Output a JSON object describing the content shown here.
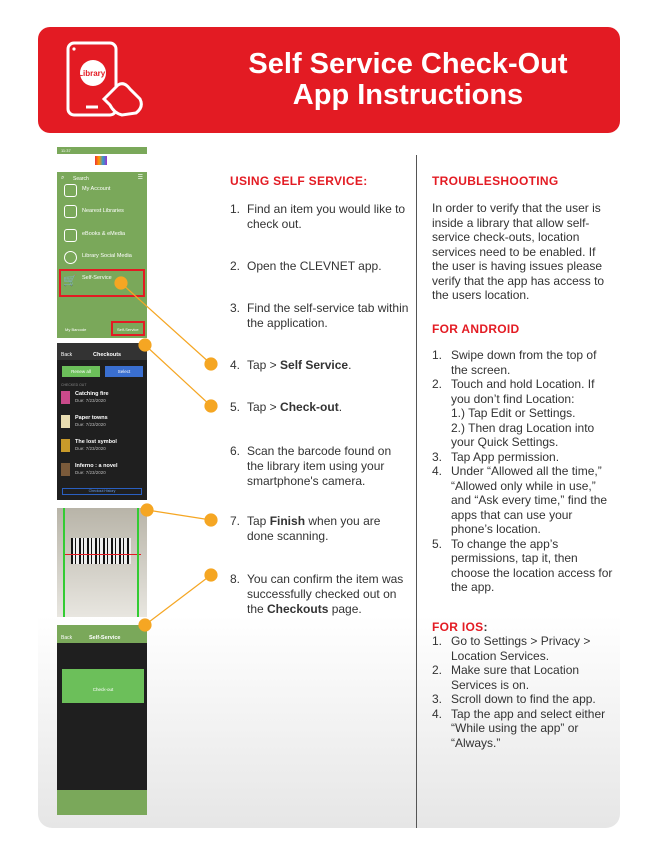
{
  "header": {
    "title_line1": "Self Service Check-Out",
    "title_line2": "App Instructions",
    "logo_text": "Library!"
  },
  "using": {
    "heading": "USING SELF SERVICE:",
    "steps": [
      {
        "n": "1.",
        "pre": "Find an item you would like to check out.",
        "bold": "",
        "post": ""
      },
      {
        "n": "2.",
        "pre": "Open the CLEVNET app.",
        "bold": "",
        "post": ""
      },
      {
        "n": "3.",
        "pre": "Find the self-service tab within the application.",
        "bold": "",
        "post": ""
      },
      {
        "n": "4.",
        "pre": "Tap > ",
        "bold": "Self Service",
        "post": "."
      },
      {
        "n": "5.",
        "pre": "Tap > ",
        "bold": "Check-out",
        "post": "."
      },
      {
        "n": "6.",
        "pre": "Scan the barcode found on the library item using your smartphone's camera.",
        "bold": "",
        "post": ""
      },
      {
        "n": "7.",
        "pre": "Tap ",
        "bold": "Finish",
        "post": " when you are done scanning."
      },
      {
        "n": "8.",
        "pre": "You can confirm the item was successfully checked out on the ",
        "bold": "Checkouts",
        "post": " page."
      }
    ]
  },
  "troubleshooting": {
    "heading": "TROUBLESHOOTING",
    "text": "In order to verify that the user is inside a library that allow self-service check-outs, location services need to be enabled. If the user is having issues please verify that the app has access to the users location."
  },
  "android": {
    "heading": "FOR ANDROID",
    "steps": [
      {
        "n": "1.",
        "text": "Swipe down from the top of the screen."
      },
      {
        "n": "2.",
        "text": "Touch and hold Location. If you don’t find Location:",
        "sub": [
          "1.) Tap Edit or Settings.",
          "2.) Then drag Location into your Quick Settings."
        ]
      },
      {
        "n": "3.",
        "text": "Tap App permission."
      },
      {
        "n": "4.",
        "text": "Under “Allowed all the time,” “Allowed only while in use,” and “Ask every time,” find the apps that can use your phone’s location."
      },
      {
        "n": "5.",
        "text": "To change the app’s permissions, tap it, then choose the location access for the app."
      }
    ]
  },
  "ios": {
    "heading": "FOR IOS",
    "colon": ":",
    "steps": [
      {
        "n": "1.",
        "text": "Go to Settings > Privacy > Location Services."
      },
      {
        "n": "2.",
        "text": "Make sure that Location Services is on."
      },
      {
        "n": "3.",
        "text": "Scroll down to find the app."
      },
      {
        "n": "4.",
        "text": "Tap the app and select either “While using the app” or “Always.”"
      }
    ]
  },
  "phone1": {
    "time": "11:37",
    "search": "Search",
    "menu": [
      "My Account",
      "Nearest Libraries",
      "eBooks & eMedia",
      "Library Social Media",
      "Self-Service"
    ],
    "bottom_left": "My Barcode",
    "bottom_right": "Self-Service"
  },
  "phone2": {
    "back": "Back",
    "title": "Checkouts",
    "renew": "Renew all",
    "select": "Select",
    "section": "CHECKED OUT",
    "books": [
      {
        "title": "Catching fire",
        "due": "Due: 7/23/2020",
        "color": "#c94a8a"
      },
      {
        "title": "Paper towns",
        "due": "Due: 7/23/2020",
        "color": "#e8dcb0"
      },
      {
        "title": "The lost symbol",
        "due": "Due: 7/23/2020",
        "color": "#c89a2a"
      },
      {
        "title": "Inferno : a novel",
        "due": "Due: 7/23/2020",
        "color": "#7a5a3a"
      }
    ],
    "history": "Checkout History"
  },
  "phone4": {
    "back": "Back",
    "title": "Self-Service",
    "checkout": "Check-out"
  },
  "colors": {
    "red": "#e31b23",
    "orange": "#f5a623",
    "green": "#7aa85a"
  }
}
